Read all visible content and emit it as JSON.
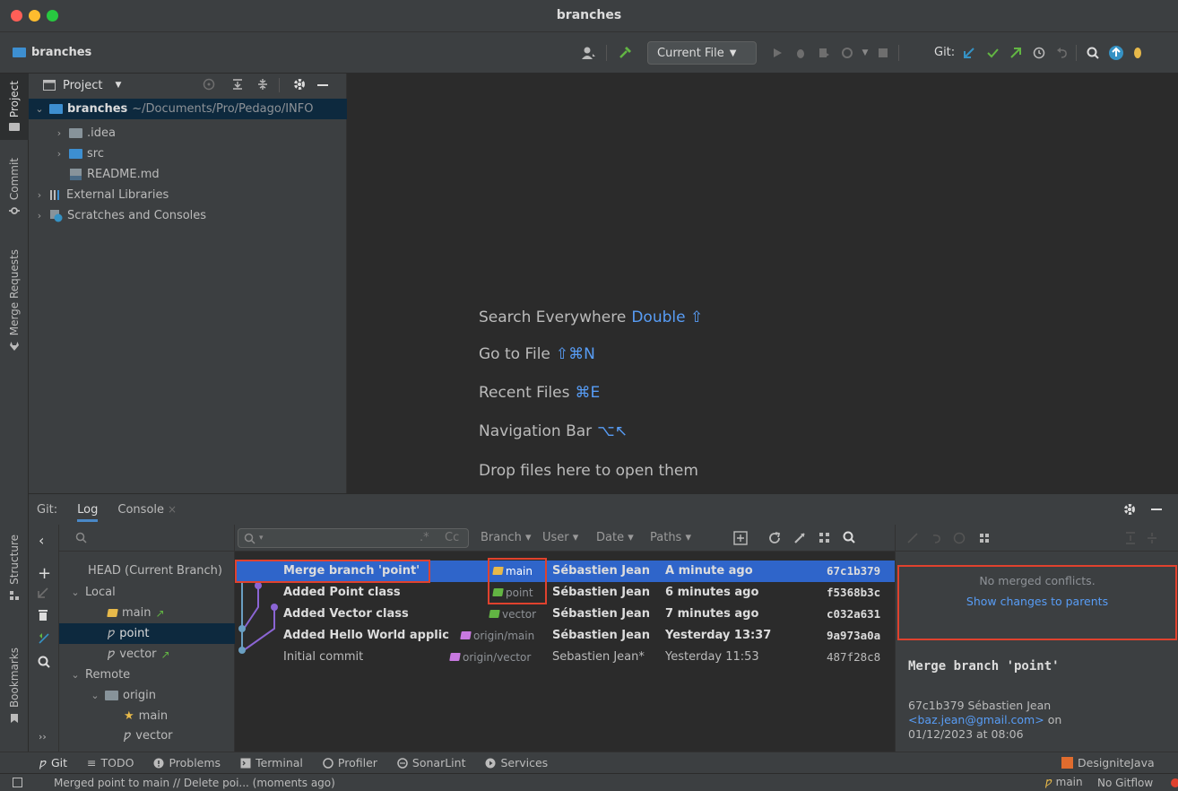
{
  "window": {
    "title": "branches"
  },
  "nav": {
    "project_name": "branches",
    "run_config": "Current File",
    "git_label": "Git:"
  },
  "left_strip": {
    "project": "Project",
    "commit": "Commit",
    "merge_requests": "Merge Requests"
  },
  "left_strip_bottom": {
    "structure": "Structure",
    "bookmarks": "Bookmarks"
  },
  "project_panel": {
    "title": "Project",
    "root_name": "branches",
    "root_path": "~/Documents/Pro/Pedago/INFO",
    "items": [
      {
        "label": ".idea"
      },
      {
        "label": "src"
      },
      {
        "label": "README.md"
      },
      {
        "label": "External Libraries"
      },
      {
        "label": "Scratches and Consoles"
      }
    ]
  },
  "editor_hints": [
    {
      "label": "Search Everywhere",
      "key": "Double ⇧"
    },
    {
      "label": "Go to File",
      "key": "⇧⌘N"
    },
    {
      "label": "Recent Files",
      "key": "⌘E"
    },
    {
      "label": "Navigation Bar",
      "key": "⌥↖"
    },
    {
      "label": "Drop files here to open them",
      "key": ""
    }
  ],
  "git_window": {
    "prefix": "Git:",
    "tabs": [
      {
        "label": "Log"
      },
      {
        "label": "Console"
      }
    ]
  },
  "branches": {
    "head": "HEAD (Current Branch)",
    "local": "Local",
    "local_items": [
      {
        "label": "main"
      },
      {
        "label": "point"
      },
      {
        "label": "vector"
      }
    ],
    "remote": "Remote",
    "origin": "origin",
    "remote_items": [
      {
        "label": "main"
      },
      {
        "label": "vector"
      }
    ]
  },
  "log_filters": {
    "search_regex": ".*",
    "search_case": "Cc",
    "branch": "Branch",
    "user": "User",
    "date": "Date",
    "paths": "Paths"
  },
  "commits": [
    {
      "subject": "Merge branch 'point'",
      "tag": "main",
      "author": "Sébastien Jean",
      "date": "A minute ago",
      "hash": "67c1b379"
    },
    {
      "subject": "Added Point class",
      "tag": "point",
      "author": "Sébastien Jean",
      "date": "6 minutes ago",
      "hash": "f5368b3c"
    },
    {
      "subject": "Added Vector class",
      "tag": "vector",
      "author": "Sébastien Jean",
      "date": "7 minutes ago",
      "hash": "c032a631"
    },
    {
      "subject": "Added Hello World applic",
      "tag": "origin/main",
      "author": "Sébastien Jean",
      "date": "Yesterday 13:37",
      "hash": "9a973a0a"
    },
    {
      "subject": "Initial commit",
      "tag": "origin/vector",
      "author": "Sebastien Jean*",
      "date": "Yesterday 11:53",
      "hash": "487f28c8"
    }
  ],
  "details": {
    "no_conflicts": "No merged conflicts.",
    "show_changes": "Show changes to parents",
    "commit_title": "Merge branch 'point'",
    "commit_meta": "67c1b379 Sébastien Jean",
    "email": "<baz.jean@gmail.com>",
    "on": " on",
    "date": "01/12/2023 at 08:06"
  },
  "bottom_tabs": [
    {
      "label": "Git"
    },
    {
      "label": "TODO"
    },
    {
      "label": "Problems"
    },
    {
      "label": "Terminal"
    },
    {
      "label": "Profiler"
    },
    {
      "label": "SonarLint"
    },
    {
      "label": "Services"
    }
  ],
  "bottom_right": "DesigniteJava",
  "status": {
    "message": "Merged point to main // Delete poi... (moments ago)",
    "branch": "main",
    "gitflow": "No Gitflow"
  },
  "colors": {
    "accent": "#2f65ca",
    "link": "#589df6",
    "highlight": "#e0422e",
    "tag": "#c879e0",
    "tag_head": "#e7b94a"
  }
}
